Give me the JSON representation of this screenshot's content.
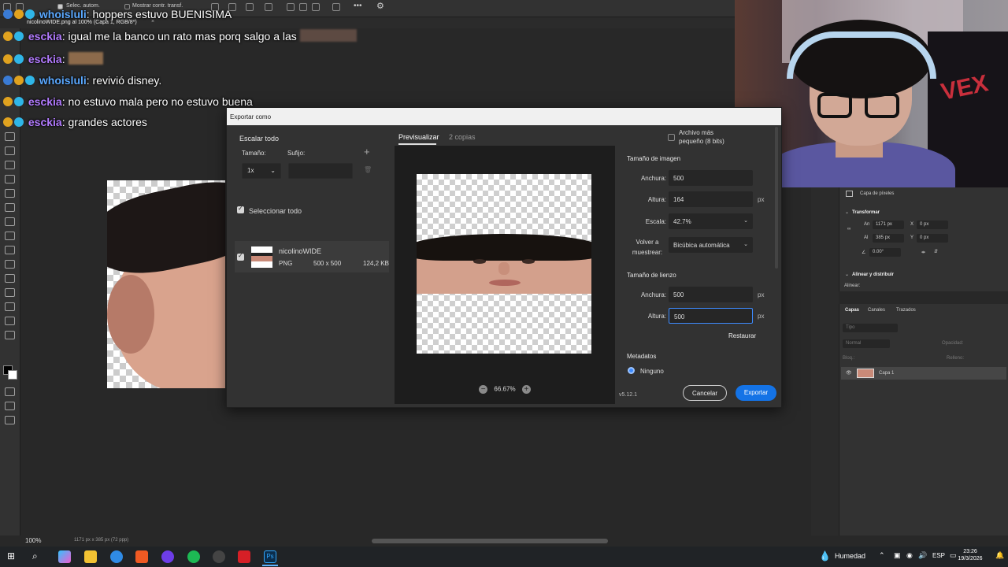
{
  "photoshop": {
    "options_bar": {
      "auto_select": "Selec. autom.",
      "transform_controls": "Mostrar contr. transf."
    },
    "doc_tab": "nicolinoWIDE.png al 100% (Capa 1, RGB/8*)",
    "status": {
      "zoom": "100%",
      "doc_info": "1171 px x 385 px (72 ppp)"
    }
  },
  "chat": [
    {
      "user": "whoisluli",
      "user_color": "#5aa8ff",
      "message": ": hoppers estuvo BUENISIMA"
    },
    {
      "user": "esckia",
      "user_color": "#b37bff",
      "message": ": igual me la banco un rato mas porq salgo a las"
    },
    {
      "user": "esckia",
      "user_color": "#b37bff",
      "message": ":"
    },
    {
      "user": "whoisluli",
      "user_color": "#5aa8ff",
      "message": ": revivió disney."
    },
    {
      "user": "esckia",
      "user_color": "#b37bff",
      "message": ": no estuvo mala pero no estuvo buena"
    },
    {
      "user": "esckia",
      "user_color": "#b37bff",
      "message": ": grandes actores"
    }
  ],
  "dialog": {
    "title": "Exportar como",
    "scale_all": "Escalar todo",
    "size_label": "Tamaño:",
    "suffix_label": "Sufijo:",
    "add_symbol": "+",
    "size_value": "1x",
    "suffix_placeholder": "",
    "select_all": "Seleccionar todo",
    "file": {
      "name": "nicolinoWIDE",
      "format": "PNG",
      "dimensions": "500 x 500",
      "size": "124,2 KB"
    },
    "tabs": {
      "preview": "Previsualizar",
      "copies": "2 copias"
    },
    "zoom": "66.67%",
    "smaller_file": "Archivo más pequeño (8 bits)",
    "image_size": {
      "title": "Tamaño de imagen",
      "width_label": "Anchura:",
      "width_value": "500",
      "height_label": "Altura:",
      "height_value": "164",
      "unit": "px",
      "scale_label": "Escala:",
      "scale_value": "42.7%",
      "resample_label": "Volver a muestrear:",
      "resample_value": "Bicúbica automática"
    },
    "canvas_size": {
      "title": "Tamaño de lienzo",
      "width_label": "Anchura:",
      "width_value": "500",
      "height_label": "Altura:",
      "height_value": "500",
      "unit": "px",
      "reset": "Restaurar"
    },
    "metadata": {
      "title": "Metadatos",
      "option": "Ninguno"
    },
    "version": "v5.12.1",
    "cancel": "Cancelar",
    "export": "Exportar"
  },
  "properties": {
    "pixel_layer": "Capa de píxeles",
    "transform": "Transformar",
    "w_label": "An",
    "w_value": "1171 px",
    "x_label": "X",
    "x_value": "0 px",
    "h_label": "Al",
    "h_value": "385 px",
    "y_label": "Y",
    "y_value": "0 px",
    "angle": "0.00°",
    "align": "Alinear y distribuir",
    "align_sub": "Alinear:"
  },
  "layers": {
    "tabs": [
      "Capas",
      "Canales",
      "Trazados"
    ],
    "search": "Tipo",
    "blend": "Normal",
    "opacity_label": "Opacidad:",
    "lock_label": "Bloq.:",
    "fill_label": "Relleno:",
    "layer_name": "Capa 1"
  },
  "webcam": {
    "shirt_text": "VEX"
  },
  "taskbar": {
    "weather": "Humedad",
    "lang": "ESP",
    "time": "23:26",
    "date": "19/3/2026"
  }
}
